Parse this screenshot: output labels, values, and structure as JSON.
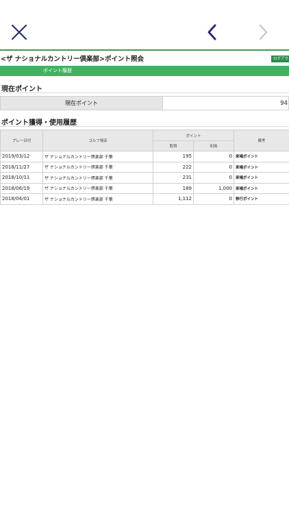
{
  "nav": {
    "close_icon": "close-icon",
    "back_icon": "chevron-left-icon",
    "forward_icon": "chevron-right-icon",
    "accent_color": "#2b2e6e",
    "disabled_color": "#c8c8c8"
  },
  "page": {
    "title": "<ザ ナショナルカントリー倶楽部>ポイント照会",
    "logout_label": "ログアウト",
    "history_tab_label": "ポイント履歴",
    "brand_green": "#3db45f"
  },
  "current_points": {
    "section_title": "現在ポイント",
    "label": "現在ポイント",
    "value": "94"
  },
  "history": {
    "section_title": "ポイント獲得・使用履歴",
    "headers": {
      "date": "プレー日付",
      "course": "ゴルフ場名",
      "points": "ポイント",
      "earned": "取得",
      "used": "利用",
      "remarks": "備考"
    },
    "rows": [
      {
        "date": "2019/03/12",
        "course": "ザ ナショナルカントリー倶楽部 千葉",
        "earned": "195",
        "used": "0",
        "remarks": "来場ポイント"
      },
      {
        "date": "2018/11/27",
        "course": "ザ ナショナルカントリー倶楽部 千葉",
        "earned": "222",
        "used": "0",
        "remarks": "来場ポイント"
      },
      {
        "date": "2018/10/11",
        "course": "ザ ナショナルカントリー倶楽部 千葉",
        "earned": "231",
        "used": "0",
        "remarks": "来場ポイント"
      },
      {
        "date": "2018/06/19",
        "course": "ザ ナショナルカントリー倶楽部 千葉",
        "earned": "189",
        "used": "1,000",
        "remarks": "来場ポイント"
      },
      {
        "date": "2018/04/01",
        "course": "ザ ナショナルカントリー倶楽部 千葉",
        "earned": "1,112",
        "used": "0",
        "remarks": "移行ポイント"
      }
    ]
  }
}
